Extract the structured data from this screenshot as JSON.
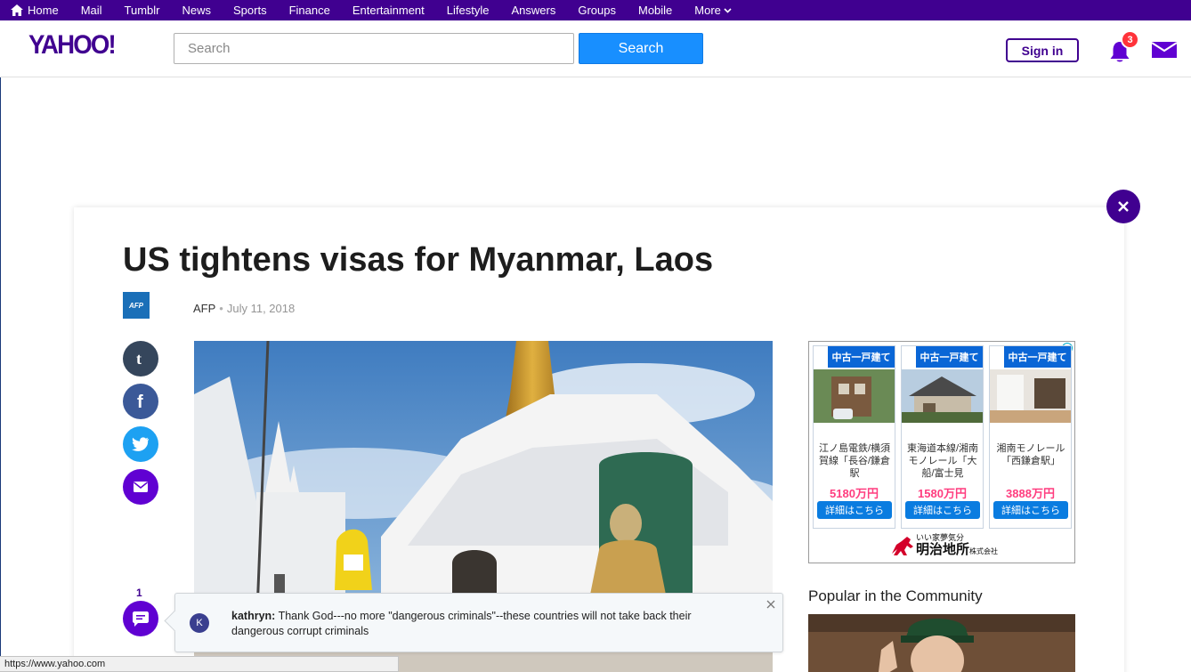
{
  "topnav": {
    "items": [
      {
        "label": "Home"
      },
      {
        "label": "Mail"
      },
      {
        "label": "Tumblr"
      },
      {
        "label": "News"
      },
      {
        "label": "Sports"
      },
      {
        "label": "Finance"
      },
      {
        "label": "Entertainment"
      },
      {
        "label": "Lifestyle"
      },
      {
        "label": "Answers"
      },
      {
        "label": "Groups"
      },
      {
        "label": "Mobile"
      },
      {
        "label": "More"
      }
    ]
  },
  "header": {
    "logo": "YAHOO!",
    "search_placeholder": "Search",
    "search_button": "Search",
    "signin": "Sign in",
    "notification_count": "3",
    "brand_color": "#400090",
    "accent_color": "#188fff"
  },
  "article": {
    "title": "US tightens visas for Myanmar, Laos",
    "source_logo": "AFP",
    "source": "AFP",
    "separator": "•",
    "date": "July 11, 2018",
    "comment_count": "1"
  },
  "share": {
    "icons": [
      "tumblr-icon",
      "facebook-icon",
      "twitter-icon",
      "email-icon"
    ]
  },
  "ad": {
    "cells": [
      {
        "tag": "中古一戸建て",
        "location": "江ノ島電鉄/横須賀線「長谷/鎌倉駅",
        "price": "5180万円",
        "cta": "詳細はこちら"
      },
      {
        "tag": "中古一戸建て",
        "location": "東海道本線/湘南モノレール「大船/富士見",
        "price": "1580万円",
        "cta": "詳細はこちら"
      },
      {
        "tag": "中古一戸建て",
        "location": "湘南モノレール「西鎌倉駅」",
        "price": "3888万円",
        "cta": "詳細はこちら"
      }
    ],
    "brand_tagline": "いい家夢気分",
    "brand_name": "明治地所",
    "brand_suffix": "株式会社"
  },
  "sidebar": {
    "popular_title": "Popular in the Community"
  },
  "comment_popup": {
    "avatar_letter": "K",
    "author": "kathryn:",
    "text": " Thank God---no more \"dangerous criminals\"--these countries will not take back their dangerous corrupt criminals"
  },
  "statusbar": {
    "url": "https://www.yahoo.com"
  }
}
